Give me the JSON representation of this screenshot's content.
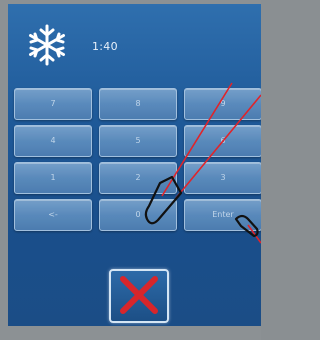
{
  "status": {
    "time": "1:40"
  },
  "keypad": {
    "rows": [
      [
        "7",
        "8",
        "9"
      ],
      [
        "4",
        "5",
        "6"
      ],
      [
        "1",
        "2",
        "3"
      ],
      [
        "<-",
        "0",
        "Enter"
      ]
    ]
  },
  "icons": {
    "mode": "snowflake-icon",
    "cancel": "cancel-x-icon"
  },
  "colors": {
    "screen": "#1f5a99",
    "key": "#5d8dbe",
    "cancel_x": "#d8262b",
    "pointer_line": "#e0242a",
    "stylus_outline": "#111111"
  }
}
